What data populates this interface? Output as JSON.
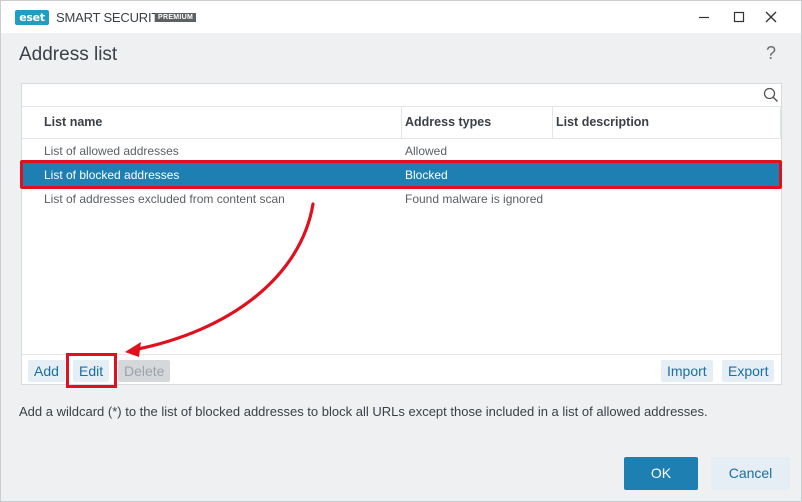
{
  "titlebar": {
    "logo_text": "eset",
    "product": "SMART SECURITY",
    "edition": "PREMIUM",
    "controls": [
      "minimize-icon",
      "maximize-icon",
      "close-icon"
    ]
  },
  "header": {
    "title": "Address list",
    "help": "?"
  },
  "table": {
    "columns": [
      "List name",
      "Address types",
      "List description"
    ],
    "rows": [
      {
        "name": "List of allowed addresses",
        "type": "Allowed",
        "description": ""
      },
      {
        "name": "List of blocked addresses",
        "type": "Blocked",
        "description": "",
        "selected": true
      },
      {
        "name": "List of addresses excluded from content scan",
        "type": "Found malware is ignored",
        "description": ""
      }
    ]
  },
  "toolbar": {
    "add": "Add",
    "edit": "Edit",
    "delete": "Delete",
    "import": "Import",
    "export": "Export"
  },
  "hint": "Add a wildcard (*) to the list of blocked addresses to block all URLs except those included in a list of allowed addresses.",
  "footer": {
    "ok": "OK",
    "cancel": "Cancel"
  },
  "colors": {
    "accent": "#1e7fb3",
    "highlight": "#e0101e",
    "brand": "#1f9fbf"
  }
}
